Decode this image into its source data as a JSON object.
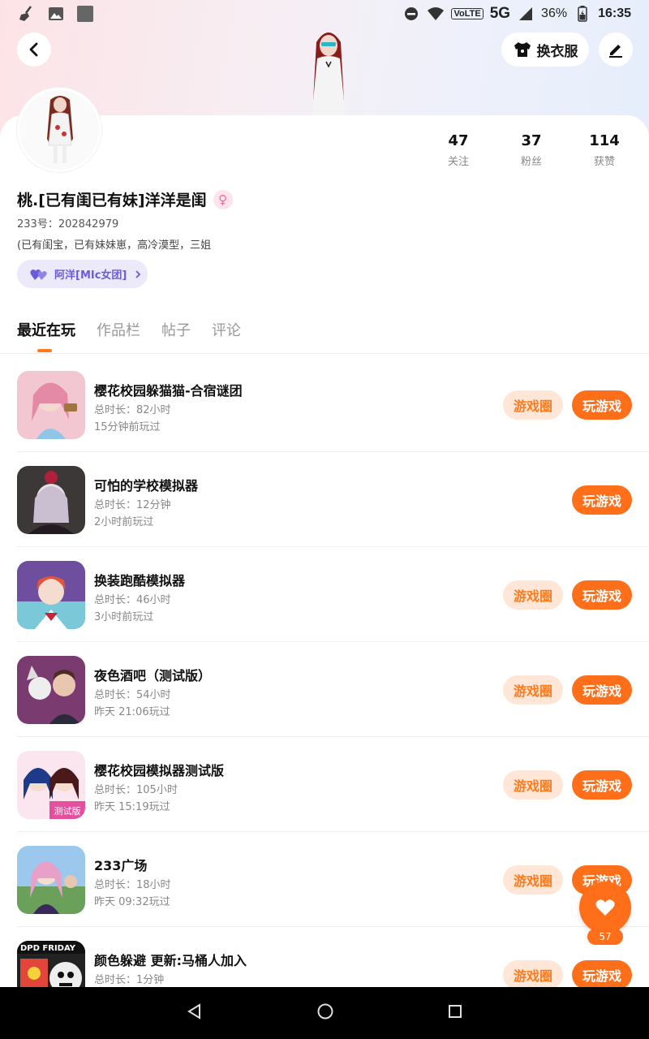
{
  "status_bar": {
    "volte": "VoLTE",
    "network": "5G",
    "battery": "36%",
    "time": "16:35"
  },
  "header": {
    "outfit_label": "换衣服"
  },
  "stats": [
    {
      "value": "47",
      "label": "关注"
    },
    {
      "value": "37",
      "label": "粉丝"
    },
    {
      "value": "114",
      "label": "获赞"
    }
  ],
  "profile": {
    "nickname": "桃.[已有闺已有妹]洋洋是闺",
    "uid": "233号：202842979",
    "bio": "(已有闺宝，已有妹妹崽，高冷漠型，三姐",
    "family": "阿洋[MIc女团]"
  },
  "tabs": [
    "最近在玩",
    "作品栏",
    "帖子",
    "评论"
  ],
  "games": [
    {
      "title": "樱花校园躲猫猫-合宿谜团",
      "duration": "总时长：82小时",
      "last": "15分钟前玩过",
      "circle": "游戏圈",
      "play": "玩游戏",
      "icon_color": "#e8a6b8"
    },
    {
      "title": "可怕的学校模拟器",
      "duration": "总时长：12分钟",
      "last": "2小时前玩过",
      "circle": "",
      "play": "玩游戏",
      "icon_color": "#5a4e52"
    },
    {
      "title": "换装跑酷模拟器",
      "duration": "总时长：46小时",
      "last": "3小时前玩过",
      "circle": "游戏圈",
      "play": "玩游戏",
      "icon_color": "#7d5aa8"
    },
    {
      "title": "夜色酒吧（测试版）",
      "duration": "总时长：54小时",
      "last": "昨天 21:06玩过",
      "circle": "游戏圈",
      "play": "玩游戏",
      "icon_color": "#8a4a7a"
    },
    {
      "title": "樱花校园模拟器测试版",
      "duration": "总时长：105小时",
      "last": "昨天 15:19玩过",
      "circle": "游戏圈",
      "play": "玩游戏",
      "icon_color": "#d85f8e"
    },
    {
      "title": "233广场",
      "duration": "总时长：18小时",
      "last": "昨天 09:32玩过",
      "circle": "游戏圈",
      "play": "玩游戏",
      "icon_color": "#6a9fd8"
    },
    {
      "title": "颜色躲避 更新:马桶人加入",
      "duration": "总时长：1分钟",
      "last": "",
      "circle": "游戏圈",
      "play": "玩游戏",
      "icon_color": "#e2463a"
    }
  ],
  "like_fab": {
    "count": "57"
  },
  "icon7_banner": "DPD FRIDAY",
  "icon5_banner": "测试版"
}
